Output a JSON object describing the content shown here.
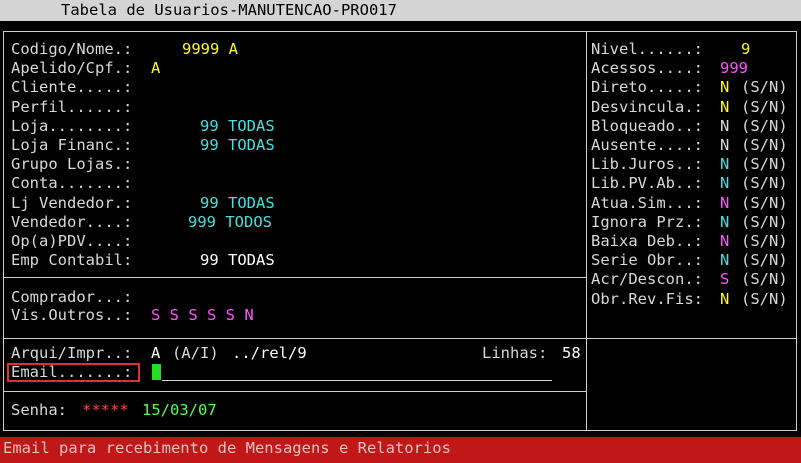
{
  "window_title": "Tabela de Usuarios-MANUTENCAO-PRO017",
  "left": {
    "rows": [
      {
        "label": "Codigo/Nome.:",
        "value": "9999 A",
        "color": "y",
        "vx": 182
      },
      {
        "label": "Apelido/Cpf.:",
        "value": "A",
        "color": "y",
        "vx": 151
      },
      {
        "label": "Cliente.....:",
        "value": "",
        "color": "w",
        "vx": 151
      },
      {
        "label": "Perfil......:",
        "value": "",
        "color": "w",
        "vx": 151
      },
      {
        "label": "Loja........:",
        "value": "99 TODAS",
        "color": "c",
        "vx": 200
      },
      {
        "label": "Loja Financ.:",
        "value": "99 TODAS",
        "color": "c",
        "vx": 200
      },
      {
        "label": "Grupo Lojas.:",
        "value": "",
        "color": "w",
        "vx": 151
      },
      {
        "label": "Conta.......:",
        "value": "",
        "color": "w",
        "vx": 151
      },
      {
        "label": "Lj Vendedor.:",
        "value": "99 TODAS",
        "color": "c",
        "vx": 200
      },
      {
        "label": "Vendedor....:",
        "value": "999 TODOS",
        "color": "c",
        "vx": 188
      },
      {
        "label": "Op(a)PDV....:",
        "value": "",
        "color": "w",
        "vx": 151
      },
      {
        "label": "Emp Contabil:",
        "value": "99 TODAS",
        "color": "bw",
        "vx": 200
      }
    ]
  },
  "middle": {
    "comprador_label": "Comprador...:",
    "visoutros_label": "Vis.Outros..:",
    "visoutros_value": "S S S S S N"
  },
  "lower": {
    "arqui_label": "Arqui/Impr..:",
    "arqui_value": "A",
    "arqui_hint": "(A/I)",
    "arqui_path": "../rel/9",
    "linhas_label": "Linhas:",
    "linhas_value": "58",
    "email_label": "Email.......:",
    "senha_label": "Senha:",
    "senha_value": "*****",
    "senha_date": "15/03/07"
  },
  "right": {
    "rows": [
      {
        "label": "Nivel......:",
        "value": "9",
        "color": "y",
        "hint": ""
      },
      {
        "label": "Acessos....:",
        "value": "999",
        "color": "m",
        "hint": ""
      },
      {
        "label": "Direto.....:",
        "value": "N",
        "color": "y",
        "hint": "(S/N)"
      },
      {
        "label": "Desvincula.:",
        "value": "N",
        "color": "y",
        "hint": "(S/N)"
      },
      {
        "label": "Bloqueado..:",
        "value": "N",
        "color": "w",
        "hint": "(S/N)"
      },
      {
        "label": "Ausente....:",
        "value": "N",
        "color": "w",
        "hint": "(S/N)"
      },
      {
        "label": "Lib.Juros..:",
        "value": "N",
        "color": "c",
        "hint": "(S/N)"
      },
      {
        "label": "Lib.PV.Ab..:",
        "value": "N",
        "color": "c",
        "hint": "(S/N)"
      },
      {
        "label": "Atua.Sim...:",
        "value": "N",
        "color": "m",
        "hint": "(S/N)"
      },
      {
        "label": "Ignora Prz.:",
        "value": "N",
        "color": "c",
        "hint": "(S/N)"
      },
      {
        "label": "Baixa Deb..:",
        "value": "N",
        "color": "m",
        "hint": "(S/N)"
      },
      {
        "label": "Serie Obr..:",
        "value": "N",
        "color": "c",
        "hint": "(S/N)"
      },
      {
        "label": "Acr/Descon.:",
        "value": "S",
        "color": "m",
        "hint": "(S/N)"
      },
      {
        "label": "Obr.Rev.Fis:",
        "value": "N",
        "color": "y",
        "hint": "(S/N)"
      }
    ]
  },
  "status_message": "Email para recebimento de Mensagens e Relatorios"
}
